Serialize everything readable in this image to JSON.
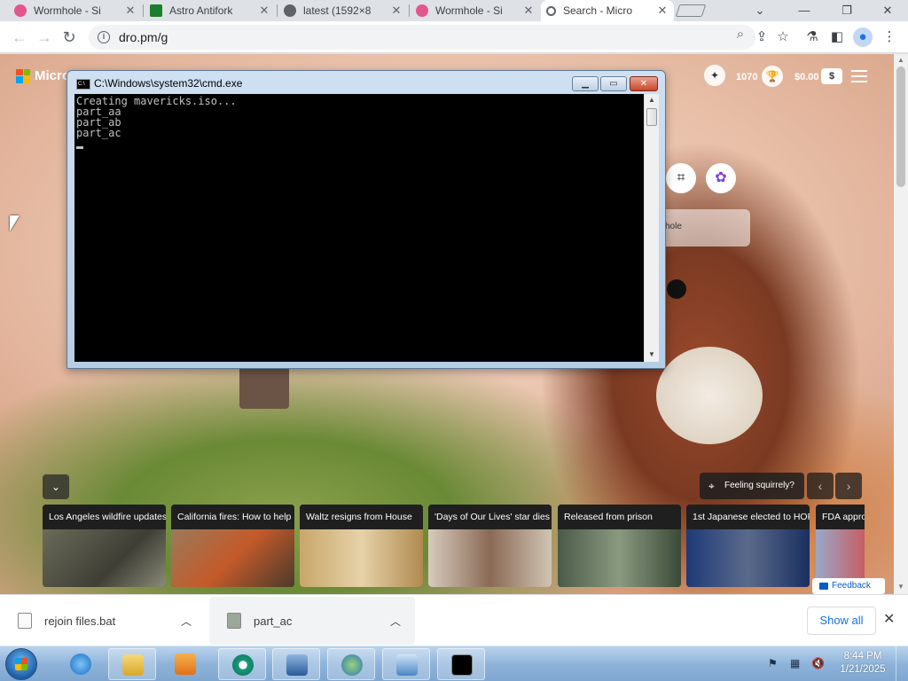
{
  "browser": {
    "tabs": [
      {
        "title": "Wormhole - Si",
        "favicon_color": "#e3568d",
        "active": false
      },
      {
        "title": "Astro Antifork",
        "favicon_color": "#1a7f2a",
        "active": false
      },
      {
        "title": "latest (1592×8",
        "favicon_color": "#5f6368",
        "active": false
      },
      {
        "title": "Wormhole - Si",
        "favicon_color": "#e3568d",
        "active": false
      },
      {
        "title": "Search - Micro",
        "favicon_color": "#5f6368",
        "active": true
      }
    ],
    "url": "dro.pm/g",
    "icons": {
      "back": "arrow-left-icon",
      "forward": "arrow-right-icon",
      "reload": "reload-icon",
      "zoom": "zoom-icon",
      "share": "share-icon",
      "bookmark": "star-icon",
      "labs": "flask-icon",
      "sidepanel": "side-panel-icon",
      "profile": "profile-icon",
      "menu": "kebab-menu-icon"
    }
  },
  "msn": {
    "brand": "Micro",
    "points": "1070",
    "balance": "$0.00",
    "dollar": "$",
    "search_hint": "hole",
    "location_label": "Feeling squirrely?",
    "feedback_label": "Feedback",
    "news": [
      {
        "title": "Los Angeles wildfire updates",
        "color": "#5a5a4a"
      },
      {
        "title": "California fires: How to help",
        "color": "#7a5a3a"
      },
      {
        "title": "Waltz resigns from House",
        "color": "#c8a66a"
      },
      {
        "title": "'Days of Our Lives' star dies",
        "color": "#c7b9a8"
      },
      {
        "title": "Released from prison",
        "color": "#5a6a55"
      },
      {
        "title": "1st Japanese elected to HOF",
        "color": "#1e3a78"
      },
      {
        "title": "FDA appro",
        "color": "#9aa8c8"
      }
    ]
  },
  "cmd": {
    "title": "C:\\Windows\\system32\\cmd.exe",
    "output": "Creating mavericks.iso...\npart_aa\npart_ab\npart_ac\n"
  },
  "downloads": {
    "items": [
      {
        "name": "rejoin files.bat"
      },
      {
        "name": "part_ac"
      }
    ],
    "show_all": "Show all"
  },
  "taskbar": {
    "time": "8:44 PM",
    "date": "1/21/2025"
  }
}
